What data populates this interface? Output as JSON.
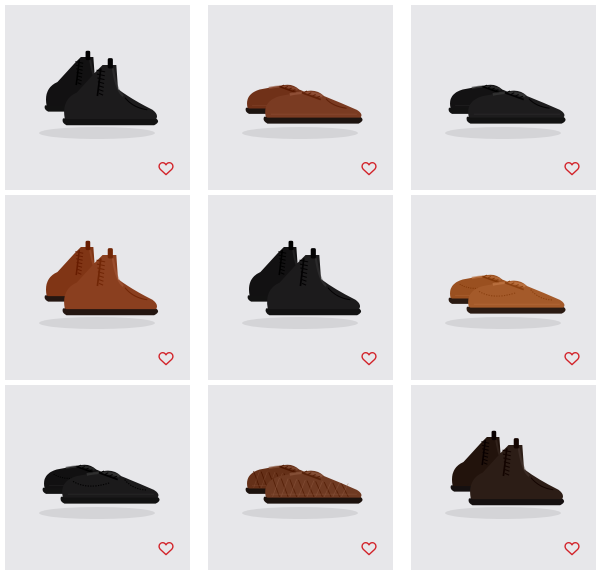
{
  "products": [
    {
      "id": "p1",
      "style": "boot",
      "color": "#1c1b1c",
      "sole": "#121212",
      "pattern": "plain",
      "wishlist_icon": "heart-outline-icon"
    },
    {
      "id": "p2",
      "style": "oxford",
      "color": "#7a3b22",
      "sole": "#1d1410",
      "pattern": "plain",
      "wishlist_icon": "heart-outline-icon"
    },
    {
      "id": "p3",
      "style": "oxford",
      "color": "#1d1c1d",
      "sole": "#121212",
      "pattern": "plain",
      "wishlist_icon": "heart-outline-icon"
    },
    {
      "id": "p4",
      "style": "boot",
      "color": "#8a3f1f",
      "sole": "#241611",
      "pattern": "plain",
      "wishlist_icon": "heart-outline-icon"
    },
    {
      "id": "p5",
      "style": "boot",
      "color": "#1c1b1c",
      "sole": "#121212",
      "pattern": "plain",
      "wishlist_icon": "heart-outline-icon"
    },
    {
      "id": "p6",
      "style": "brogue",
      "color": "#a45a2a",
      "sole": "#2a1a12",
      "pattern": "brogue",
      "wishlist_icon": "heart-outline-icon"
    },
    {
      "id": "p7",
      "style": "brogue",
      "color": "#1b1a1b",
      "sole": "#121212",
      "pattern": "brogue",
      "wishlist_icon": "heart-outline-icon"
    },
    {
      "id": "p8",
      "style": "woven",
      "color": "#6f3a22",
      "sole": "#1c120d",
      "pattern": "woven",
      "wishlist_icon": "heart-outline-icon"
    },
    {
      "id": "p9",
      "style": "boot",
      "color": "#2c1d16",
      "sole": "#151010",
      "pattern": "plain",
      "wishlist_icon": "heart-outline-icon"
    }
  ],
  "colors": {
    "card_background": "#e7e7ea",
    "heart": "#d2232a"
  }
}
